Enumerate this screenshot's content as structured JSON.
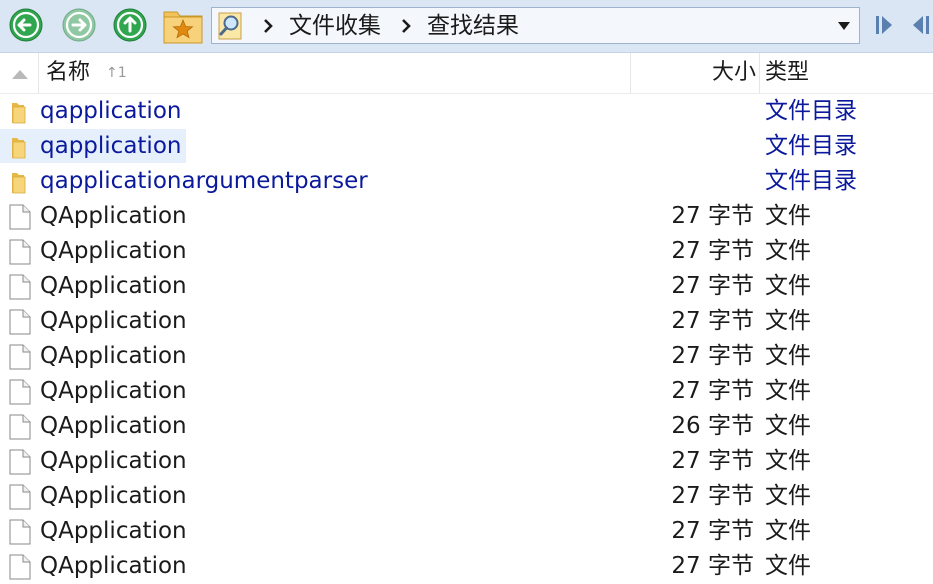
{
  "toolbar": {
    "breadcrumb": [
      "文件收集",
      "查找结果"
    ]
  },
  "header": {
    "name": "名称",
    "sort_indicator": "↑1",
    "size": "大小",
    "type": "类型"
  },
  "rows": [
    {
      "kind": "folder",
      "name": "qapplication",
      "size": "",
      "type": "文件目录",
      "selected": false
    },
    {
      "kind": "folder",
      "name": "qapplication",
      "size": "",
      "type": "文件目录",
      "selected": true
    },
    {
      "kind": "folder",
      "name": "qapplicationargumentparser",
      "size": "",
      "type": "文件目录",
      "selected": false
    },
    {
      "kind": "file",
      "name": "QApplication",
      "size": "27 字节",
      "type": "文件",
      "selected": false
    },
    {
      "kind": "file",
      "name": "QApplication",
      "size": "27 字节",
      "type": "文件",
      "selected": false
    },
    {
      "kind": "file",
      "name": "QApplication",
      "size": "27 字节",
      "type": "文件",
      "selected": false
    },
    {
      "kind": "file",
      "name": "QApplication",
      "size": "27 字节",
      "type": "文件",
      "selected": false
    },
    {
      "kind": "file",
      "name": "QApplication",
      "size": "27 字节",
      "type": "文件",
      "selected": false
    },
    {
      "kind": "file",
      "name": "QApplication",
      "size": "27 字节",
      "type": "文件",
      "selected": false
    },
    {
      "kind": "file",
      "name": "QApplication",
      "size": "26 字节",
      "type": "文件",
      "selected": false
    },
    {
      "kind": "file",
      "name": "QApplication",
      "size": "27 字节",
      "type": "文件",
      "selected": false
    },
    {
      "kind": "file",
      "name": "QApplication",
      "size": "27 字节",
      "type": "文件",
      "selected": false
    },
    {
      "kind": "file",
      "name": "QApplication",
      "size": "27 字节",
      "type": "文件",
      "selected": false
    },
    {
      "kind": "file",
      "name": "QApplication",
      "size": "27 字节",
      "type": "文件",
      "selected": false
    }
  ],
  "colors": {
    "folder_text": "#0b1a9c",
    "nav_green": "#2ea44f",
    "toolbar_bg": "#dbe6f4"
  }
}
